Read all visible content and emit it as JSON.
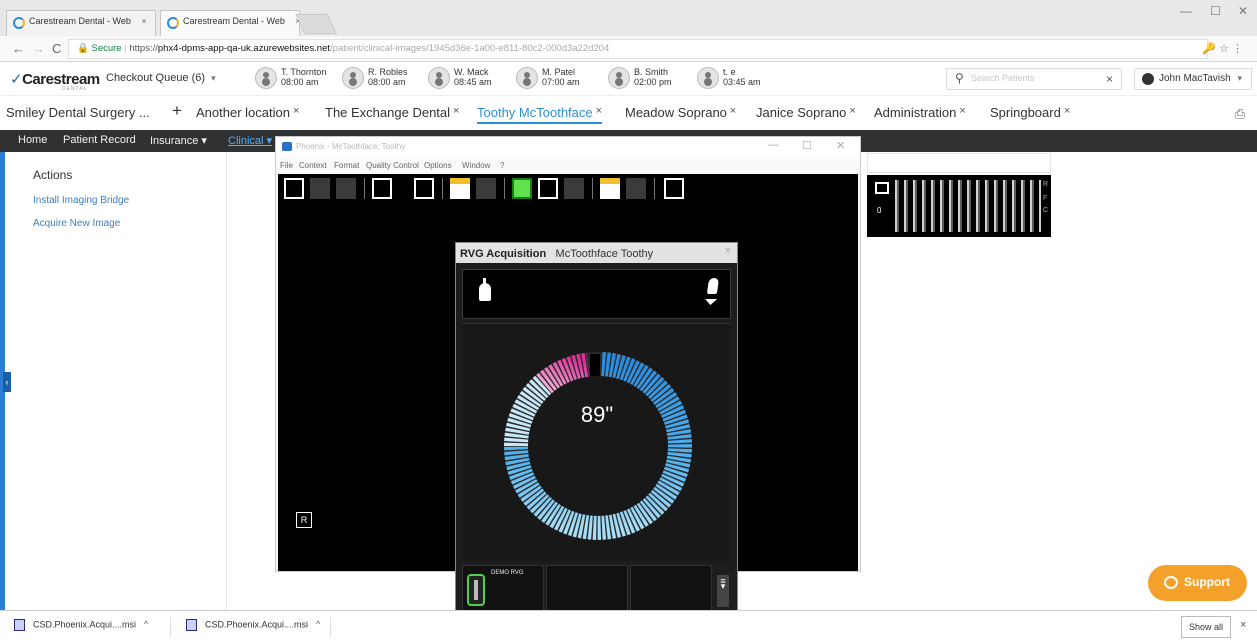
{
  "browser": {
    "tabs": [
      {
        "label": "Carestream Dental - Web",
        "close": "×"
      },
      {
        "label": "Carestream Dental - Web",
        "close": "×"
      }
    ],
    "url": {
      "secure_label": "Secure",
      "protocol": "https://",
      "host": "phx4-dpms-app-qa-uk.azurewebsites.net",
      "path": "/patient/clinical-images/1945d36e-1a00-e811-80c2-000d3a22d204"
    },
    "omni_icons": "🔑 ☆ ⋮"
  },
  "app": {
    "logo": "Carestream",
    "logo_sub": "DENTAL",
    "queue_label": "Checkout Queue (6)",
    "providers": [
      {
        "name": "T. Thornton",
        "time": "08:00 am"
      },
      {
        "name": "R. Robles",
        "time": "08:00 am"
      },
      {
        "name": "W. Mack",
        "time": "08:45 am"
      },
      {
        "name": "M. Patel",
        "time": "07:00 am"
      },
      {
        "name": "B. Smith",
        "time": "02:00 pm"
      },
      {
        "name": "t. e",
        "time": "03:45 am"
      }
    ],
    "search_placeholder": "Search Patients",
    "user": "John MacTavish"
  },
  "location_tabs": [
    {
      "label": "Smiley Dental Surgery ...",
      "closable": false
    },
    {
      "label": "Another location",
      "closable": true
    },
    {
      "label": "The Exchange Dental",
      "closable": true
    },
    {
      "label": "Toothy McToothface",
      "closable": true
    },
    {
      "label": "Meadow Soprano",
      "closable": true
    },
    {
      "label": "Janice Soprano",
      "closable": true
    },
    {
      "label": "Administration",
      "closable": true
    },
    {
      "label": "Springboard",
      "closable": true
    }
  ],
  "close_glyph": "×",
  "plus_glyph": "+",
  "navbar": {
    "home": "Home",
    "patient_record": "Patient Record",
    "insurance": "Insurance ▾",
    "clinical": "Clinical ▾"
  },
  "sidebar": {
    "title": "Actions",
    "links": [
      "Install Imaging Bridge",
      "Acquire New Image"
    ]
  },
  "phoenix": {
    "title": "Phoenix - McToothface, Toothy",
    "menu": [
      "File",
      "Context",
      "Format",
      "Quality Control",
      "Options",
      "Window",
      "?"
    ],
    "r_badge": "R"
  },
  "thumbnail": {
    "index": "0",
    "side_labels": [
      "R",
      "F",
      "C"
    ]
  },
  "rvg": {
    "title": "RVG Acquisition",
    "patient": "McToothface Toothy",
    "close": "×",
    "timer": "89\"",
    "timer_seconds": 89,
    "sensor_label": "DEMO RVG",
    "colors": {
      "accent_blue": "#3aa0e8",
      "accent_pink": "#e03aa8",
      "sensor_green": "#4ed24e"
    }
  },
  "support_label": "Support",
  "downloads": {
    "items": [
      "CSD.Phoenix.Acqui....msi",
      "CSD.Phoenix.Acqui....msi"
    ],
    "caret": "^",
    "show_all": "Show all",
    "close": "×"
  }
}
